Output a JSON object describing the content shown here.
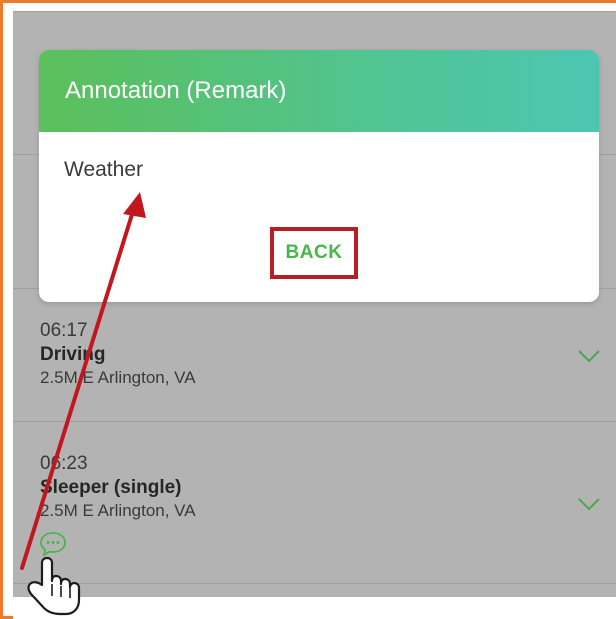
{
  "modal": {
    "title": "Annotation (Remark)",
    "remark_text": "Weather",
    "back_label": "BACK"
  },
  "log_entries": [
    {
      "time": "06:17",
      "status": "Driving",
      "location": "2.5M E Arlington, VA",
      "expand_icon": "chevron-down-icon"
    },
    {
      "time": "06:23",
      "status": "Sleeper (single)",
      "location": "2.5M E Arlington, VA",
      "expand_icon": "chevron-down-icon",
      "remark_icon": "comment-icon"
    }
  ],
  "colors": {
    "accent_green": "#49b649",
    "header_gradient_start": "#5bbf5a",
    "header_gradient_end": "#4cc6b2",
    "highlight_red": "#b51f24",
    "frame_orange": "#f07a2b"
  },
  "annotations": {
    "arrow": "red-arrow-from-remark-icon-to-remark-text",
    "cursor": "hand-pointer-icon"
  }
}
